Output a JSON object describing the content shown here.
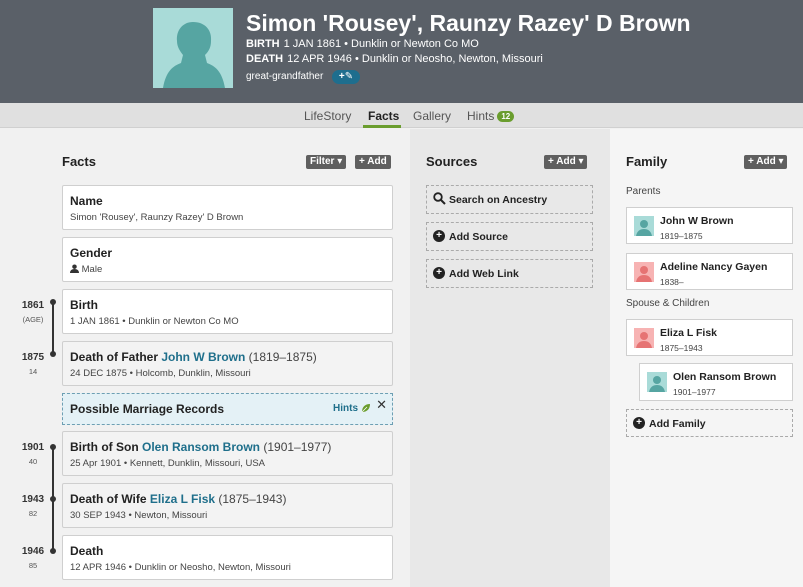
{
  "header": {
    "name": "Simon 'Rousey', Raunzy Razey' D Brown",
    "birth_label": "BIRTH",
    "birth_value": "1 JAN 1861 • Dunklin or Newton Co MO",
    "death_label": "DEATH",
    "death_value": "12 APR 1946 • Dunklin or Neosho, Newton, Missouri",
    "relationship": "great-grandfather",
    "relationship_button": "+✎"
  },
  "tabs": [
    {
      "label": "LifeStory"
    },
    {
      "label": "Facts"
    },
    {
      "label": "Gallery"
    },
    {
      "label": "Hints",
      "badge": "12"
    }
  ],
  "facts": {
    "title": "Facts",
    "filter_label": "Filter ▾",
    "add_label": "+ Add",
    "items": [
      {
        "title": "Name",
        "detail": "Simon 'Rousey', Raunzy Razey' D Brown"
      },
      {
        "title": "Gender",
        "detail": "Male"
      },
      {
        "title": "Birth",
        "detail": "1 JAN 1861 • Dunklin or Newton Co MO",
        "year": "1861",
        "age": "(AGE)"
      },
      {
        "title_prefix": "Death of Father ",
        "title_link": "John W Brown",
        "title_years": " (1819–1875)",
        "detail": "24 DEC 1875 • Holcomb, Dunklin, Missouri",
        "year": "1875",
        "age": "14"
      },
      {
        "title_prefix": "Birth of Son ",
        "title_link": "Olen Ransom Brown",
        "title_years": " (1901–1977)",
        "detail": "25 Apr 1901 • Kennett, Dunklin, Missouri, USA",
        "year": "1901",
        "age": "40"
      },
      {
        "title_prefix": "Death of Wife ",
        "title_link": "Eliza L Fisk",
        "title_years": " (1875–1943)",
        "detail": "30 SEP 1943 • Newton, Missouri",
        "year": "1943",
        "age": "82"
      },
      {
        "title": "Death",
        "detail": "12 APR 1946 • Dunklin or Neosho, Newton, Missouri",
        "year": "1946",
        "age": "85"
      }
    ],
    "hint_card": {
      "title": "Possible Marriage Records",
      "hints_label": "Hints",
      "close": "✕"
    }
  },
  "sources": {
    "title": "Sources",
    "add_label": "+ Add ▾",
    "buttons": [
      "Search on Ancestry",
      "Add Source",
      "Add Web Link"
    ]
  },
  "family": {
    "title": "Family",
    "add_label": "+ Add ▾",
    "parents_label": "Parents",
    "spouse_label": "Spouse & Children",
    "parents": [
      {
        "name": "John W Brown",
        "dates": "1819–1875",
        "gender": "male"
      },
      {
        "name": "Adeline Nancy Gayen",
        "dates": "1838–",
        "gender": "female"
      }
    ],
    "spouse": {
      "name": "Eliza L Fisk",
      "dates": "1875–1943",
      "gender": "female"
    },
    "children": [
      {
        "name": "Olen Ransom Brown",
        "dates": "1901–1977",
        "gender": "male"
      }
    ],
    "add_family_label": "Add Family"
  },
  "colors": {
    "header": "#5a6068",
    "accent": "#6a9d2e",
    "link": "#1f6f8b",
    "male": "#6cc3c0",
    "female": "#f08a8a"
  }
}
